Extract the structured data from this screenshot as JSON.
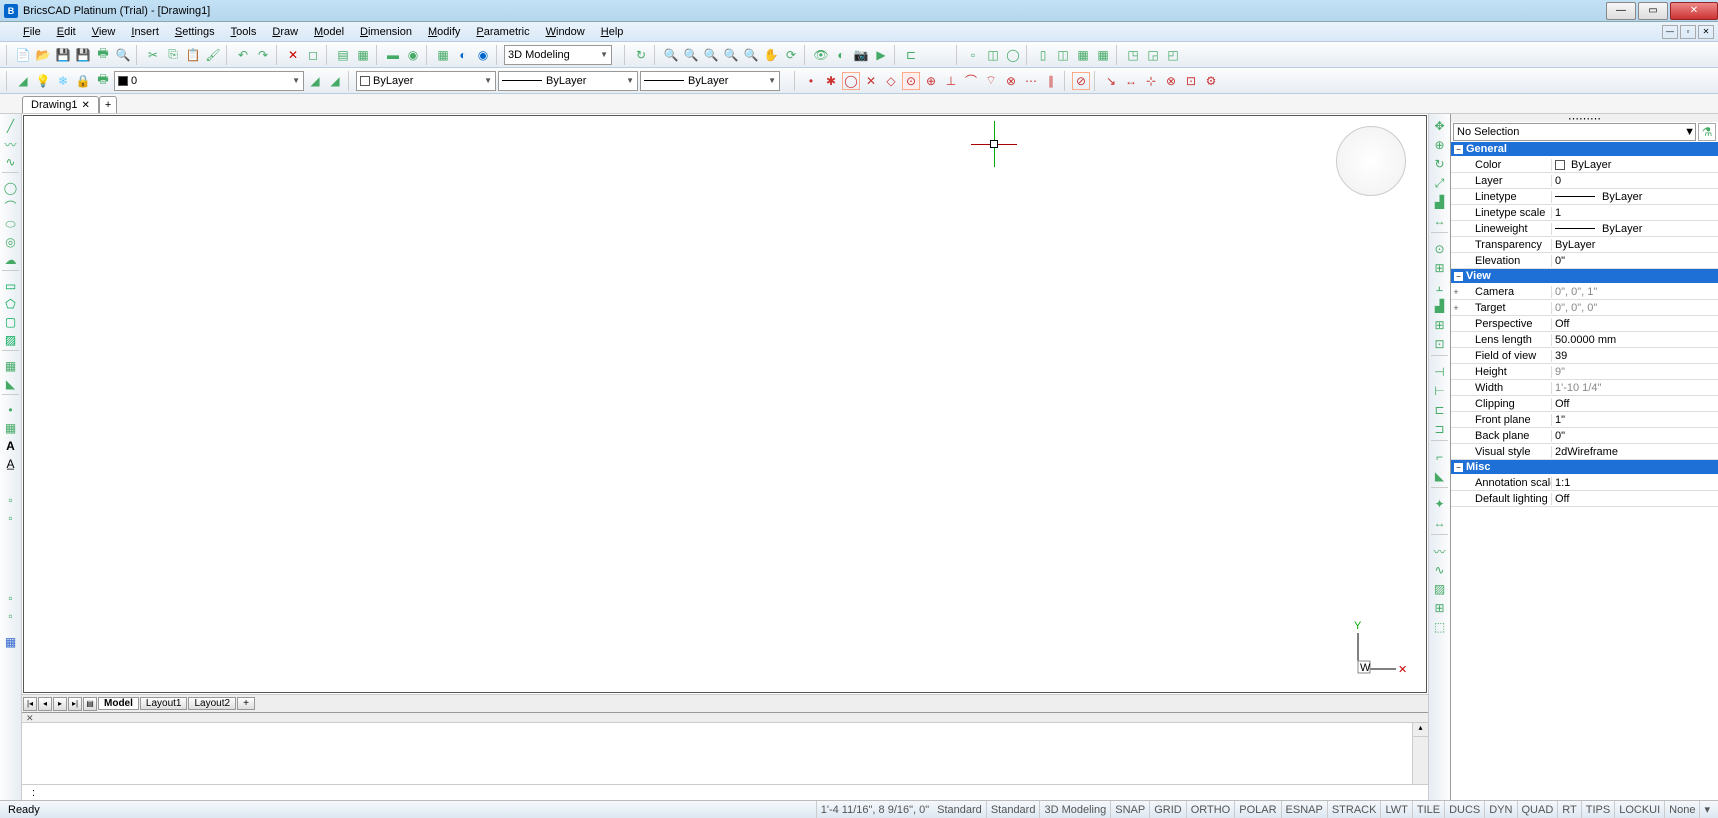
{
  "title": "BricsCAD Platinum (Trial) - [Drawing1]",
  "menus": [
    "File",
    "Edit",
    "View",
    "Insert",
    "Settings",
    "Tools",
    "Draw",
    "Model",
    "Dimension",
    "Modify",
    "Parametric",
    "Window",
    "Help"
  ],
  "workspace_dropdown": "3D Modeling",
  "layer_dropdown": "0",
  "color_dropdown": "ByLayer",
  "linetype_dropdown": "ByLayer",
  "lineweight_dropdown": "ByLayer",
  "drawing_tab": "Drawing1",
  "layout_tabs": {
    "active": "Model",
    "others": [
      "Layout1",
      "Layout2"
    ]
  },
  "cmd_prompt": ":",
  "status_ready": "Ready",
  "status_coords": "1'-4 11/16\", 8 9/16\", 0\"",
  "status_fields": [
    "Standard",
    "Standard",
    "3D Modeling",
    "SNAP",
    "GRID",
    "ORTHO",
    "POLAR",
    "ESNAP",
    "STRACK",
    "LWT",
    "TILE",
    "DUCS",
    "DYN",
    "QUAD",
    "RT",
    "TIPS",
    "LOCKUI",
    "None"
  ],
  "properties": {
    "selection": "No Selection",
    "groups": [
      {
        "name": "General",
        "rows": [
          {
            "n": "Color",
            "v": "ByLayer",
            "sw": true
          },
          {
            "n": "Layer",
            "v": "0"
          },
          {
            "n": "Linetype",
            "v": "ByLayer",
            "line": true
          },
          {
            "n": "Linetype scale",
            "v": "1"
          },
          {
            "n": "Lineweight",
            "v": "ByLayer",
            "line": true
          },
          {
            "n": "Transparency",
            "v": "ByLayer"
          },
          {
            "n": "Elevation",
            "v": "0\""
          }
        ]
      },
      {
        "name": "View",
        "rows": [
          {
            "n": "Camera",
            "v": "0\", 0\", 1\"",
            "gray": true,
            "exp": true
          },
          {
            "n": "Target",
            "v": "0\", 0\", 0\"",
            "gray": true,
            "exp": true
          },
          {
            "n": "Perspective",
            "v": "Off"
          },
          {
            "n": "Lens length",
            "v": "50.0000 mm"
          },
          {
            "n": "Field of view",
            "v": "39"
          },
          {
            "n": "Height",
            "v": "9\"",
            "gray": true
          },
          {
            "n": "Width",
            "v": "1'-10 1/4\"",
            "gray": true
          },
          {
            "n": "Clipping",
            "v": "Off"
          },
          {
            "n": "Front plane",
            "v": "1\""
          },
          {
            "n": "Back plane",
            "v": "0\""
          },
          {
            "n": "Visual style",
            "v": "2dWireframe"
          }
        ]
      },
      {
        "name": "Misc",
        "rows": [
          {
            "n": "Annotation scale",
            "v": "1:1"
          },
          {
            "n": "Default lighting",
            "v": "Off"
          }
        ]
      }
    ]
  },
  "ucs_label": "W",
  "axis_y": "Y"
}
